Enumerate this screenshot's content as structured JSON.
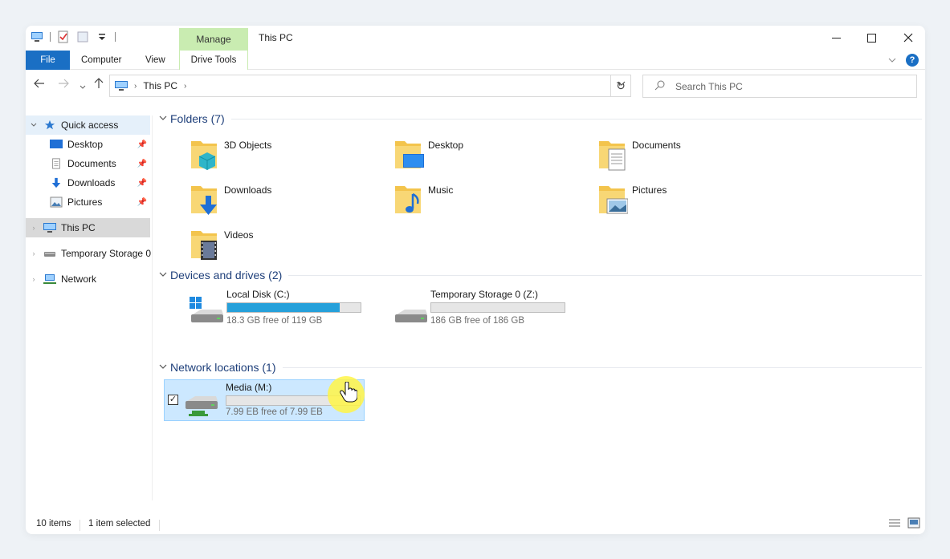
{
  "window": {
    "title": "This PC",
    "manage_tab": "Manage"
  },
  "ribbon": {
    "tabs": [
      "File",
      "Computer",
      "View",
      "Drive Tools"
    ]
  },
  "address": {
    "path": "This PC",
    "search_placeholder": "Search This PC"
  },
  "sidebar": {
    "items": [
      {
        "label": "Quick access",
        "icon": "star-icon"
      },
      {
        "label": "Desktop",
        "icon": "desktop-icon",
        "pinned": true
      },
      {
        "label": "Documents",
        "icon": "documents-icon",
        "pinned": true
      },
      {
        "label": "Downloads",
        "icon": "downloads-icon",
        "pinned": true
      },
      {
        "label": "Pictures",
        "icon": "pictures-icon",
        "pinned": true
      },
      {
        "label": "This PC",
        "icon": "computer-icon"
      },
      {
        "label": "Temporary Storage 0",
        "icon": "drive-icon"
      },
      {
        "label": "Network",
        "icon": "network-icon"
      }
    ]
  },
  "groups": {
    "folders": "Folders (7)",
    "drives": "Devices and drives (2)",
    "network": "Network locations (1)"
  },
  "folders": [
    {
      "label": "3D Objects",
      "icon": "3d-objects-folder-icon"
    },
    {
      "label": "Desktop",
      "icon": "desktop-folder-icon"
    },
    {
      "label": "Documents",
      "icon": "documents-folder-icon"
    },
    {
      "label": "Downloads",
      "icon": "downloads-folder-icon"
    },
    {
      "label": "Music",
      "icon": "music-folder-icon"
    },
    {
      "label": "Pictures",
      "icon": "pictures-folder-icon"
    },
    {
      "label": "Videos",
      "icon": "videos-folder-icon"
    }
  ],
  "drives": [
    {
      "name": "Local Disk (C:)",
      "free": "18.3 GB free of 119 GB",
      "used_fraction": 0.846
    },
    {
      "name": "Temporary Storage 0 (Z:)",
      "free": "186 GB free of 186 GB",
      "used_fraction": 0.0
    }
  ],
  "network_locations": [
    {
      "name": "Media (M:)",
      "free": "7.99 EB free of 7.99 EB",
      "used_fraction": 0.0,
      "selected": true
    }
  ],
  "status": {
    "count": "10 items",
    "selected": "1 item selected"
  },
  "colors": {
    "accent": "#1a6fc4",
    "manage_tab": "#c9ecb1",
    "selection": "#cce8ff",
    "bar_fill": "#26a0da"
  }
}
